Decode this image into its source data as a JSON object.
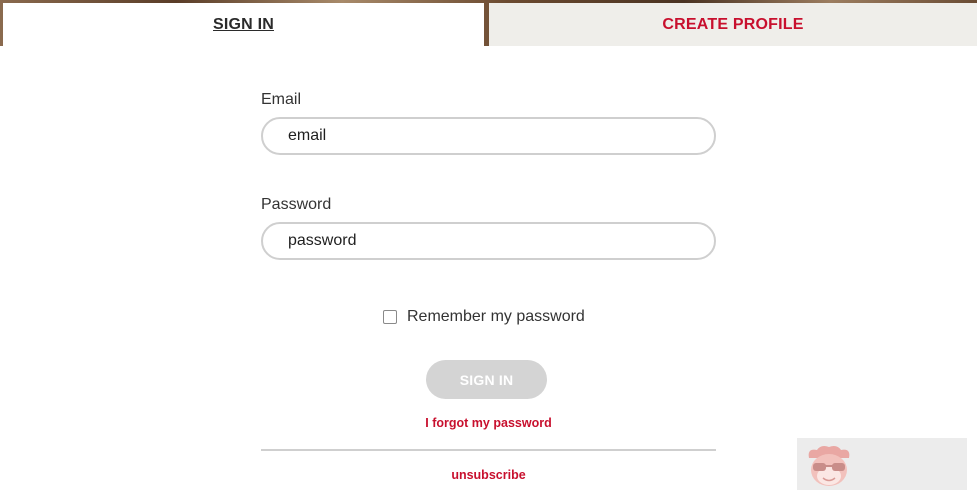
{
  "tabs": {
    "sign_in": "SIGN IN",
    "create_profile": "CREATE PROFILE"
  },
  "form": {
    "email_label": "Email",
    "email_placeholder": "email",
    "password_label": "Password",
    "password_placeholder": "password",
    "remember_label": "Remember my password",
    "submit_label": "SIGN IN",
    "forgot_link": "I forgot my password",
    "unsubscribe_link": "unsubscribe"
  },
  "colors": {
    "accent": "#c8102e",
    "disabled_button": "#d4d4d4",
    "inactive_tab": "#efeeea"
  },
  "icons": {
    "mascot": "sunglasses-mascot-icon"
  }
}
